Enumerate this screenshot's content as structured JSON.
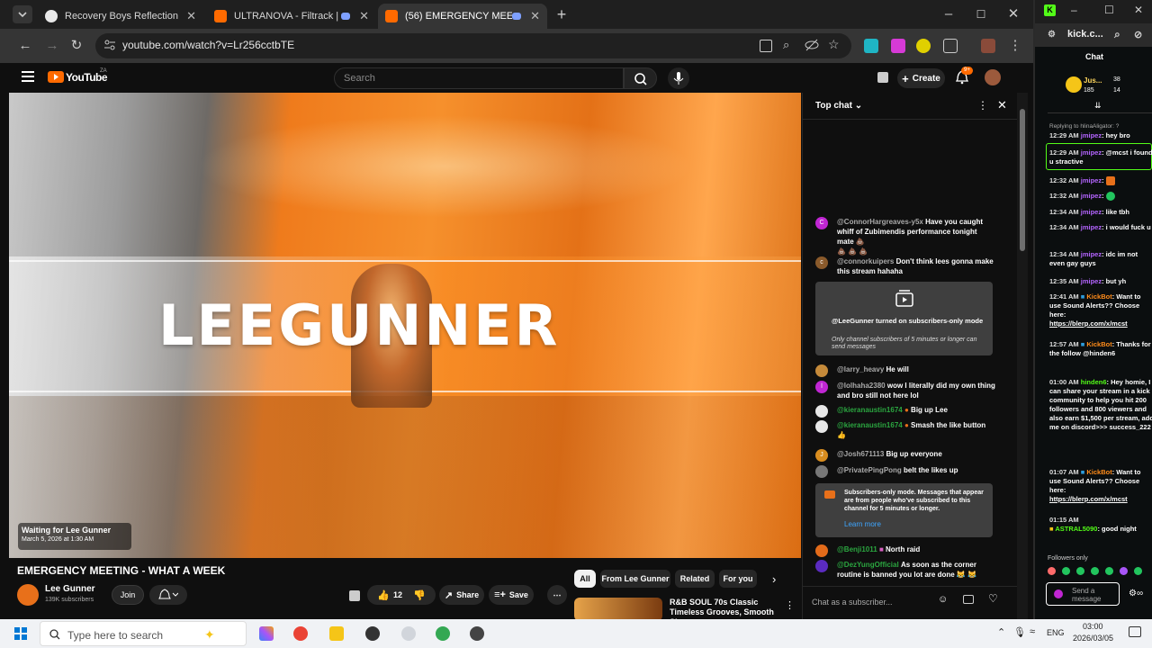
{
  "browser": {
    "tabs": [
      {
        "label": "Recovery Boys Reflection",
        "color": "#e8e8e8"
      },
      {
        "label": "ULTRANOVA - Filtrack | HÖ",
        "color": "#ff6a00"
      },
      {
        "label": "(56) EMERGENCY MEETING",
        "color": "#ff6a00"
      }
    ],
    "url": "youtube.com/watch?v=Lr256cctbTE"
  },
  "youtube": {
    "logo_text": "YouTube",
    "logo_sup": "ZA",
    "search_placeholder": "Search",
    "create_label": "Create",
    "notif_count": "9+",
    "player": {
      "wordmark": "LEEGUNNER",
      "waiting_title": "Waiting for Lee Gunner",
      "waiting_date": "March 5, 2026 at 1:30 AM"
    },
    "video_title": "EMERGENCY MEETING - WHAT A WEEK",
    "channel": {
      "name": "Lee Gunner",
      "subs": "139K subscribers",
      "join": "Join"
    },
    "actions": {
      "likes": "12",
      "share": "Share",
      "save": "Save"
    },
    "chips": [
      "All",
      "From Lee Gunner",
      "Related",
      "For you"
    ],
    "recommended_title": "R&B SOUL 70s Classic Timeless Grooves, Smooth Slo..."
  },
  "chat": {
    "mode": "Top chat",
    "messages": [
      {
        "author": "@ConnorHargreaves-y5x",
        "text": "Have you caught whiff of Zubimendis performance tonight mate 💩",
        "extra": "💩 💩 💩",
        "color": "#c026d3",
        "initial": "C",
        "member": false
      },
      {
        "author": "@connorkuipers",
        "text": "Don't think lees gonna make this stream hahaha",
        "color": "#8a5a2b",
        "initial": "c",
        "member": false
      },
      {
        "author": "@larry_heavy",
        "text": "He will",
        "color": "#c58a3a",
        "initial": "",
        "member": false
      },
      {
        "author": "@lolhaha2380",
        "text": "wow I literally did my own thing and bro still not here lol",
        "color": "#c026d3",
        "initial": "l",
        "member": false
      },
      {
        "author": "@kieranaustin1674",
        "text": "Big up Lee",
        "color": "#e8e8e8",
        "initial": "",
        "member": true
      },
      {
        "author": "@kieranaustin1674",
        "text": "Smash the like button",
        "extra": "👍",
        "color": "#e8e8e8",
        "initial": "",
        "member": true
      },
      {
        "author": "@Josh671113",
        "text": "Big up everyone",
        "color": "#d98d1f",
        "initial": "J",
        "member": false
      },
      {
        "author": "@PrivatePingPong",
        "text": "belt the likes up",
        "color": "#777",
        "initial": "",
        "member": false
      },
      {
        "author": "@Benji1011",
        "text": "North raid",
        "color": "#e36b1a",
        "initial": "",
        "member": true
      },
      {
        "author": "@DezYungOfficial",
        "text": "As soon as the corner routine is banned you lot are done 😹 😹",
        "color": "#5b2bc0",
        "initial": "",
        "member": true
      }
    ],
    "system1": {
      "author": "@LeeGunner",
      "text": "turned on subscribers-only mode",
      "sub": "Only channel subscribers of 5 minutes or longer can send messages"
    },
    "system2": {
      "text": "Subscribers-only mode. Messages that appear are from people who've subscribed to this channel for 5 minutes or longer.",
      "link": "Learn more"
    },
    "input_placeholder": "Chat as a subscriber..."
  },
  "taskbar": {
    "search_placeholder": "Type here to search",
    "lang": "ENG",
    "time": "03:00",
    "date": "2026/03/05"
  },
  "kick": {
    "url": "kick.c...",
    "chat_title": "Chat",
    "top_user": "Jus...",
    "top_stats": [
      "185",
      "38",
      "14"
    ],
    "replying": "Replying to hlinaAligator: ?",
    "messages": [
      {
        "time": "12:29 AM",
        "user": "jmipez",
        "text": ": hey bro",
        "cls": "u"
      },
      {
        "time": "12:29 AM",
        "user": "jmipez",
        "text": ": @mcst i found u stractive",
        "cls": "u"
      },
      {
        "time": "12:32 AM",
        "user": "jmipez",
        "text": ":",
        "cls": "u"
      },
      {
        "time": "12:32 AM",
        "user": "jmipez",
        "text": ":",
        "cls": "u"
      },
      {
        "time": "12:34 AM",
        "user": "jmipez",
        "text": ": like tbh",
        "cls": "u"
      },
      {
        "time": "12:34 AM",
        "user": "jmipez",
        "text": ": i would fuck u",
        "cls": "u"
      },
      {
        "time": "12:34 AM",
        "user": "jmipez",
        "text": ": idc im not even gay guys",
        "cls": "u"
      },
      {
        "time": "12:35 AM",
        "user": "jmipez",
        "text": ": but yh",
        "cls": "u"
      },
      {
        "time": "12:41 AM",
        "user": "KickBot",
        "text": ": Want to use Sound Alerts?? Choose here:",
        "link": "https://blerp.com/x/mcst",
        "cls": "u2"
      },
      {
        "time": "12:57 AM",
        "user": "KickBot",
        "text": ": Thanks for the follow @hinden6",
        "cls": "u2"
      },
      {
        "time": "01:00 AM",
        "user": "hinden6",
        "text": ": Hey homie, I can share your stream in a kick community to help you hit 200 followers and 800 viewers and also earn $1,500 per stream, add me on discord>>> success_222",
        "cls": "u3"
      },
      {
        "time": "01:07 AM",
        "user": "KickBot",
        "text": ": Want to use Sound Alerts?? Choose here:",
        "link": "https://blerp.com/x/mcst",
        "cls": "u2"
      },
      {
        "time": "01:15 AM",
        "user": "ASTRAL5090",
        "text": ": good night",
        "cls": "u3"
      }
    ],
    "followers_only": "Followers only",
    "send_placeholder": "Send a message"
  }
}
